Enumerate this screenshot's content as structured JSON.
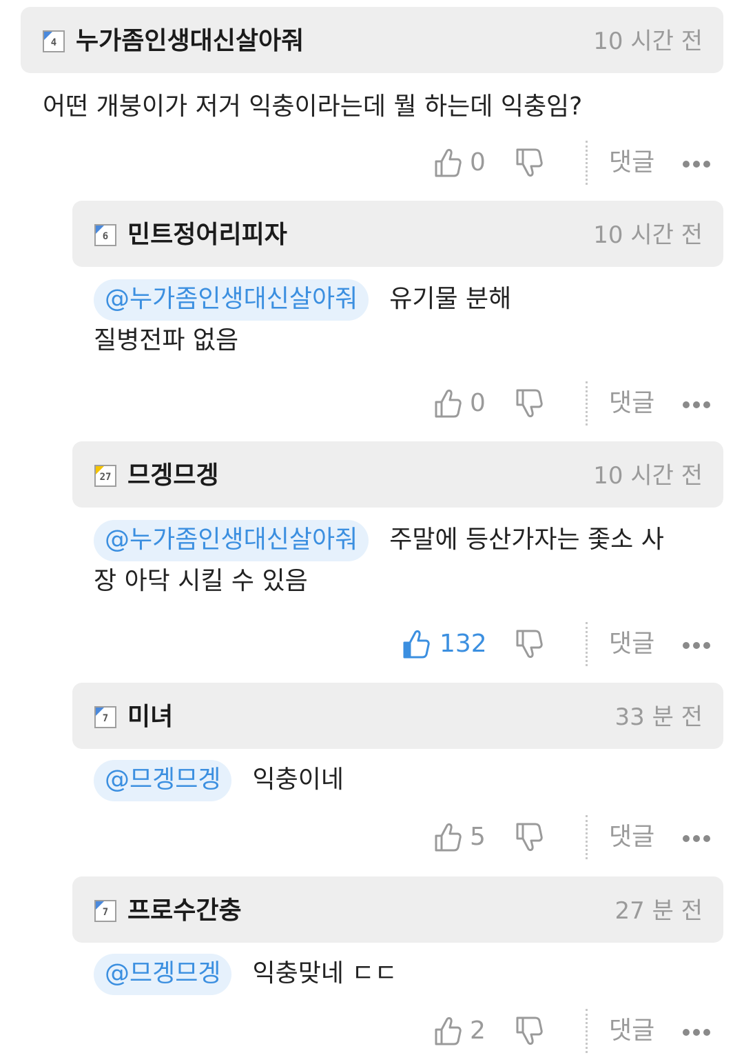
{
  "ui": {
    "reply_label": "댓글"
  },
  "comments": [
    {
      "level": "4",
      "badge_color": "#4a89dc",
      "nickname": "누가좀인생대신살아줘",
      "time": "10 시간 전",
      "mention": "",
      "line1": "어떤 개붕이가 저거 익충이라는데 뭘 하는데 익충임?",
      "line2": "",
      "likes": "0",
      "liked": false
    },
    {
      "level": "6",
      "badge_color": "#4a89dc",
      "nickname": "민트정어리피자",
      "time": "10 시간 전",
      "mention": "@누가좀인생대신살아줘",
      "line1": "유기물 분해",
      "line2": "질병전파 없음",
      "likes": "0",
      "liked": false
    },
    {
      "level": "27",
      "badge_color": "#f5c400",
      "nickname": "므겡므겡",
      "time": "10 시간 전",
      "mention": "@누가좀인생대신살아줘",
      "line1": "주말에 등산가자는 좇소 사",
      "line2": "장 아닥 시킬 수 있음",
      "likes": "132",
      "liked": true
    },
    {
      "level": "7",
      "badge_color": "#4a89dc",
      "nickname": "미녀",
      "time": "33 분 전",
      "mention": "@므겡므겡",
      "line1": "익충이네",
      "line2": "",
      "likes": "5",
      "liked": false
    },
    {
      "level": "7",
      "badge_color": "#4a89dc",
      "nickname": "프로수간충",
      "time": "27 분 전",
      "mention": "@므겡므겡",
      "line1": "익충맞네 ㄷㄷ",
      "line2": "",
      "likes": "2",
      "liked": false
    }
  ]
}
